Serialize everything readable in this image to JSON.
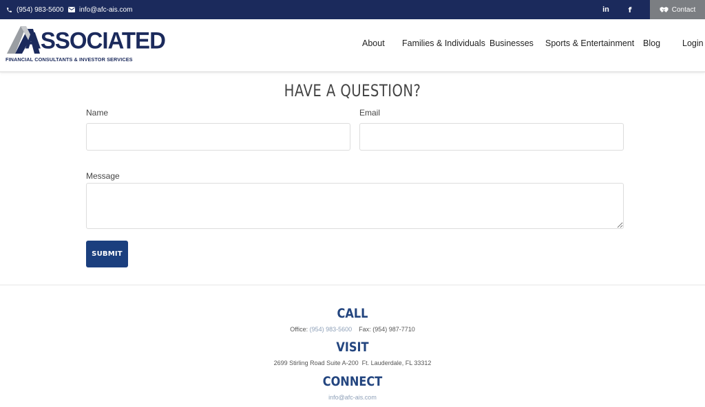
{
  "topbar": {
    "phone": "(954) 983-5600",
    "email": "info@afc-ais.com",
    "linkedin_label": "in",
    "facebook_label": "f",
    "contact_label": "Contact",
    "bar_color": "#1b2a5c",
    "contact_bg": "#7b7e82"
  },
  "header": {
    "logo_word": "ASSOCIATED",
    "logo_subtitle": "FINANCIAL CONSULTANTS & INVESTOR SERVICES",
    "nav": [
      "About",
      "Families & Individuals",
      "Businesses",
      "Sports & Entertainment",
      "Blog",
      "Login"
    ]
  },
  "form": {
    "title": "HAVE A QUESTION?",
    "name_label": "Name",
    "name_value": "",
    "email_label": "Email",
    "email_value": "",
    "message_label": "Message",
    "message_value": "",
    "submit_label": "SUBMIT",
    "button_color": "#1b3f7e"
  },
  "call": {
    "title": "CALL",
    "office_label": "Office:",
    "office_phone": "(954) 983-5600",
    "fax_label": "Fax:",
    "fax_number": "(954) 987-7710"
  },
  "visit": {
    "title": "VISIT",
    "address": "2699 Stirling Road Suite A-200",
    "city": "Ft. Lauderdale, FL 33312"
  },
  "connect": {
    "title": "CONNECT",
    "email": "info@afc-ais.com"
  }
}
